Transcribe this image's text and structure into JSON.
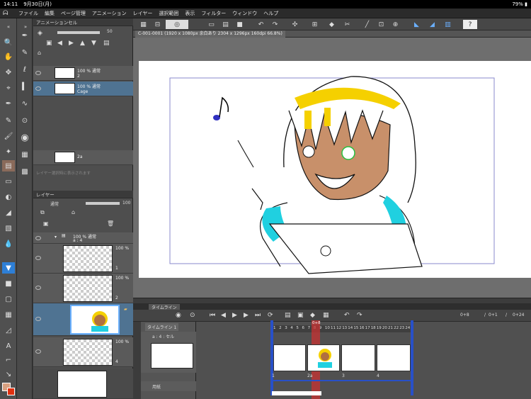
{
  "status_bar": {
    "time": "14:11",
    "date": "9月30日(月)",
    "battery": "79%"
  },
  "menu": {
    "items": [
      "ファイル",
      "編集",
      "ページ管理",
      "アニメーション",
      "レイヤー",
      "選択範囲",
      "表示",
      "フィルター",
      "ウィンドウ",
      "ヘルプ"
    ]
  },
  "animation_panel": {
    "title": "アニメーションセル",
    "opacity": "50",
    "cel1": {
      "label": "100 % 通常",
      "name": "2"
    },
    "cel2": {
      "label": "100 % 通常",
      "name": "Cage"
    },
    "cel3": {
      "name": "2a"
    },
    "hint": "レイヤー選択時に表示されます"
  },
  "layer_panel": {
    "title": "レイヤー",
    "blend_mode": "通常",
    "opacity": "100",
    "folder": {
      "label": "100 % 通常",
      "name": "a : 4"
    },
    "layers": [
      {
        "pct": "100 %",
        "name": "1"
      },
      {
        "pct": "100 %",
        "name": "2"
      },
      {
        "pct": "100 %",
        "name": ""
      },
      {
        "pct": "100 %",
        "name": "4"
      }
    ]
  },
  "document": {
    "tab_title": "C-001-0001 (1920 x 1080px 余白あり 2304 x 1296px 160dpi 66.8%)"
  },
  "timeline": {
    "title": "タイムライン",
    "track_name": "タイムライン 1",
    "cel_track": "a : 4 : セル",
    "camera_track": "用紙",
    "frame_current": "0+8",
    "frame_count_a": "0+1",
    "frame_count_b": "0+24",
    "frames": [
      "1",
      "2",
      "3",
      "4",
      "5",
      "6",
      "7",
      "8",
      "9",
      "10",
      "11",
      "12",
      "13",
      "14",
      "15",
      "16",
      "17",
      "18",
      "19",
      "20",
      "21",
      "22",
      "23",
      "24"
    ],
    "cell_labels": [
      "1",
      "2a",
      "3",
      "4"
    ],
    "playhead_label": "0+8"
  },
  "colors": {
    "accent": "#2e7fd6",
    "panel": "#4e4e4e",
    "selected_row": "#4f7392",
    "playhead": "#c0392b"
  }
}
